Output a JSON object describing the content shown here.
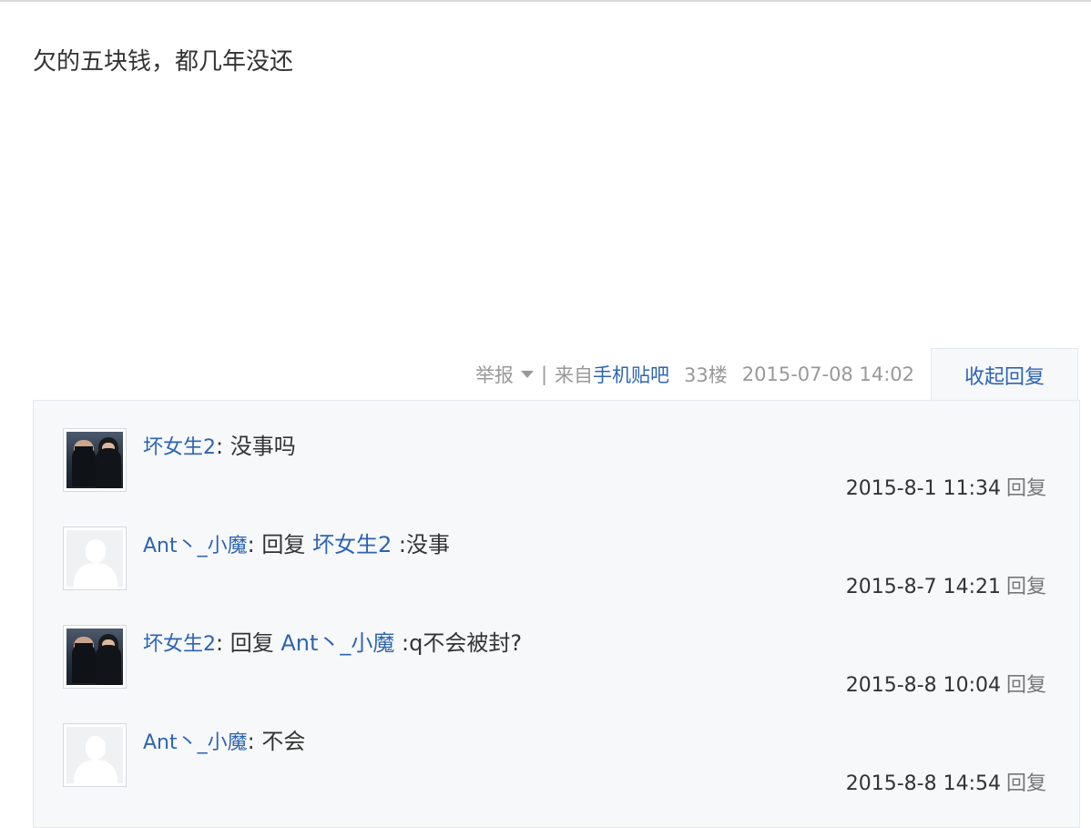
{
  "post": {
    "content": "欠的五块钱，都几年没还"
  },
  "meta": {
    "report_label": "举报",
    "separator": "|",
    "source_prefix": "来自",
    "client": "手机贴吧",
    "floor": "33楼",
    "time": "2015-07-08 14:02"
  },
  "collapse_label": "收起回复",
  "replies": [
    {
      "user": "坏女生2",
      "colon": ":",
      "reply_word": "",
      "target": "",
      "text": " 没事吗",
      "time": "2015-8-1 11:34",
      "reply_label": "回复"
    },
    {
      "user": "Ant丶_小魔",
      "colon": ":",
      "reply_word": " 回复 ",
      "target": "坏女生2",
      "text": " :没事",
      "time": "2015-8-7 14:21",
      "reply_label": "回复"
    },
    {
      "user": "坏女生2",
      "colon": ":",
      "reply_word": " 回复 ",
      "target": "Ant丶_小魔",
      "text": " :q不会被封?",
      "time": "2015-8-8 10:04",
      "reply_label": "回复"
    },
    {
      "user": "Ant丶_小魔",
      "colon": ":",
      "reply_word": "",
      "target": "",
      "text": " 不会",
      "time": "2015-8-8 14:54",
      "reply_label": "回复"
    }
  ],
  "colors": {
    "link": "#2d64b3",
    "panel_bg": "#f7f8fa",
    "meta_gray": "#999999"
  },
  "icons": {
    "avatar_photo": "user-photo-avatar",
    "avatar_default": "default-avatar-icon",
    "caret": "caret-down-icon"
  }
}
